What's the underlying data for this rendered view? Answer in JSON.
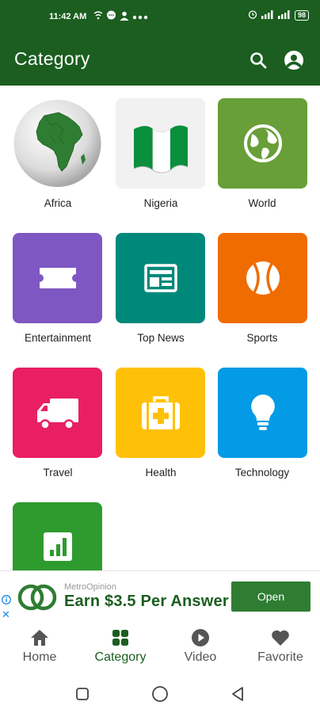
{
  "status_bar": {
    "time": "11:42 AM",
    "left_icons": [
      "wifi-call-icon",
      "chat-bubble-icon",
      "person-icon",
      "more-dots-icon"
    ],
    "right_icons": [
      "alarm-icon",
      "signal-icon",
      "signal-icon"
    ],
    "battery": "98"
  },
  "app_bar": {
    "title": "Category",
    "icons": [
      "search-icon",
      "account-icon"
    ],
    "color": "#1b5e20"
  },
  "categories": [
    {
      "label": "Africa",
      "icon": "africa-globe-icon",
      "color": "#ffffff"
    },
    {
      "label": "Nigeria",
      "icon": "nigeria-flag-icon",
      "color": "#f1f1f1"
    },
    {
      "label": "World",
      "icon": "globe-icon",
      "color": "#689f38"
    },
    {
      "label": "Entertainment",
      "icon": "ticket-icon",
      "color": "#7e57c2"
    },
    {
      "label": "Top News",
      "icon": "newspaper-icon",
      "color": "#00897b"
    },
    {
      "label": "Sports",
      "icon": "tennis-ball-icon",
      "color": "#ef6c00"
    },
    {
      "label": "Travel",
      "icon": "truck-icon",
      "color": "#e91e63"
    },
    {
      "label": "Health",
      "icon": "medical-kit-icon",
      "color": "#ffc107"
    },
    {
      "label": "Technology",
      "icon": "lightbulb-icon",
      "color": "#039be5"
    },
    {
      "label": "",
      "icon": "bar-chart-icon",
      "color": "#2e9b2e"
    }
  ],
  "ad": {
    "brand": "MetroOpinion",
    "headline": "Earn $3.5 Per Answer",
    "button": "Open"
  },
  "bottom_nav": [
    {
      "label": "Home",
      "icon": "home-icon"
    },
    {
      "label": "Category",
      "icon": "grid-icon",
      "active": true
    },
    {
      "label": "Video",
      "icon": "play-circle-icon"
    },
    {
      "label": "Favorite",
      "icon": "heart-icon"
    }
  ],
  "system_nav": [
    "recent-apps-icon",
    "home-circle-icon",
    "back-icon"
  ]
}
